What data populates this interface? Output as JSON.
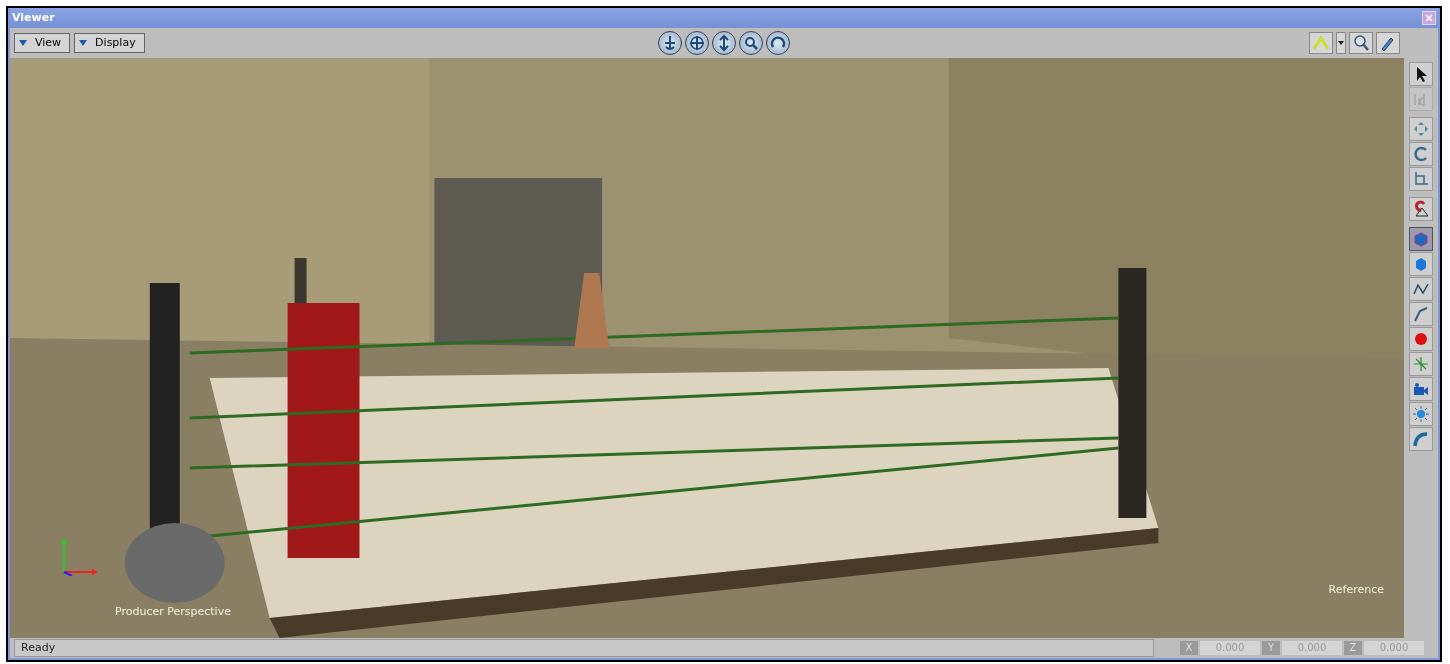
{
  "window": {
    "title": "Viewer"
  },
  "toolbar": {
    "menus": [
      {
        "label": "View"
      },
      {
        "label": "Display"
      }
    ]
  },
  "right_toolbar": {
    "tools": [
      {
        "kind": "select",
        "selected": false,
        "disabled": false
      },
      {
        "kind": "text",
        "selected": false,
        "disabled": true
      },
      {
        "kind": "move",
        "selected": false,
        "disabled": false
      },
      {
        "kind": "rotate",
        "selected": false,
        "disabled": false
      },
      {
        "kind": "scale",
        "selected": false,
        "disabled": false
      },
      {
        "kind": "magnet",
        "selected": false,
        "disabled": false
      },
      {
        "kind": "create",
        "selected": true,
        "disabled": false
      },
      {
        "kind": "cube",
        "selected": false,
        "disabled": false
      },
      {
        "kind": "curve",
        "selected": false,
        "disabled": false
      },
      {
        "kind": "bone",
        "selected": false,
        "disabled": false
      },
      {
        "kind": "sphere",
        "selected": false,
        "disabled": false
      },
      {
        "kind": "axes",
        "selected": false,
        "disabled": false
      },
      {
        "kind": "camera",
        "selected": false,
        "disabled": false
      },
      {
        "kind": "light",
        "selected": false,
        "disabled": false
      },
      {
        "kind": "tube",
        "selected": false,
        "disabled": false
      }
    ]
  },
  "viewport": {
    "camera_label": "Producer Perspective",
    "view_label": "Reference"
  },
  "status_bar": {
    "text": "Ready",
    "coordinates": [
      {
        "axis": "X",
        "value": "0.000"
      },
      {
        "axis": "Y",
        "value": "0.000"
      },
      {
        "axis": "Z",
        "value": "0.000"
      }
    ]
  }
}
